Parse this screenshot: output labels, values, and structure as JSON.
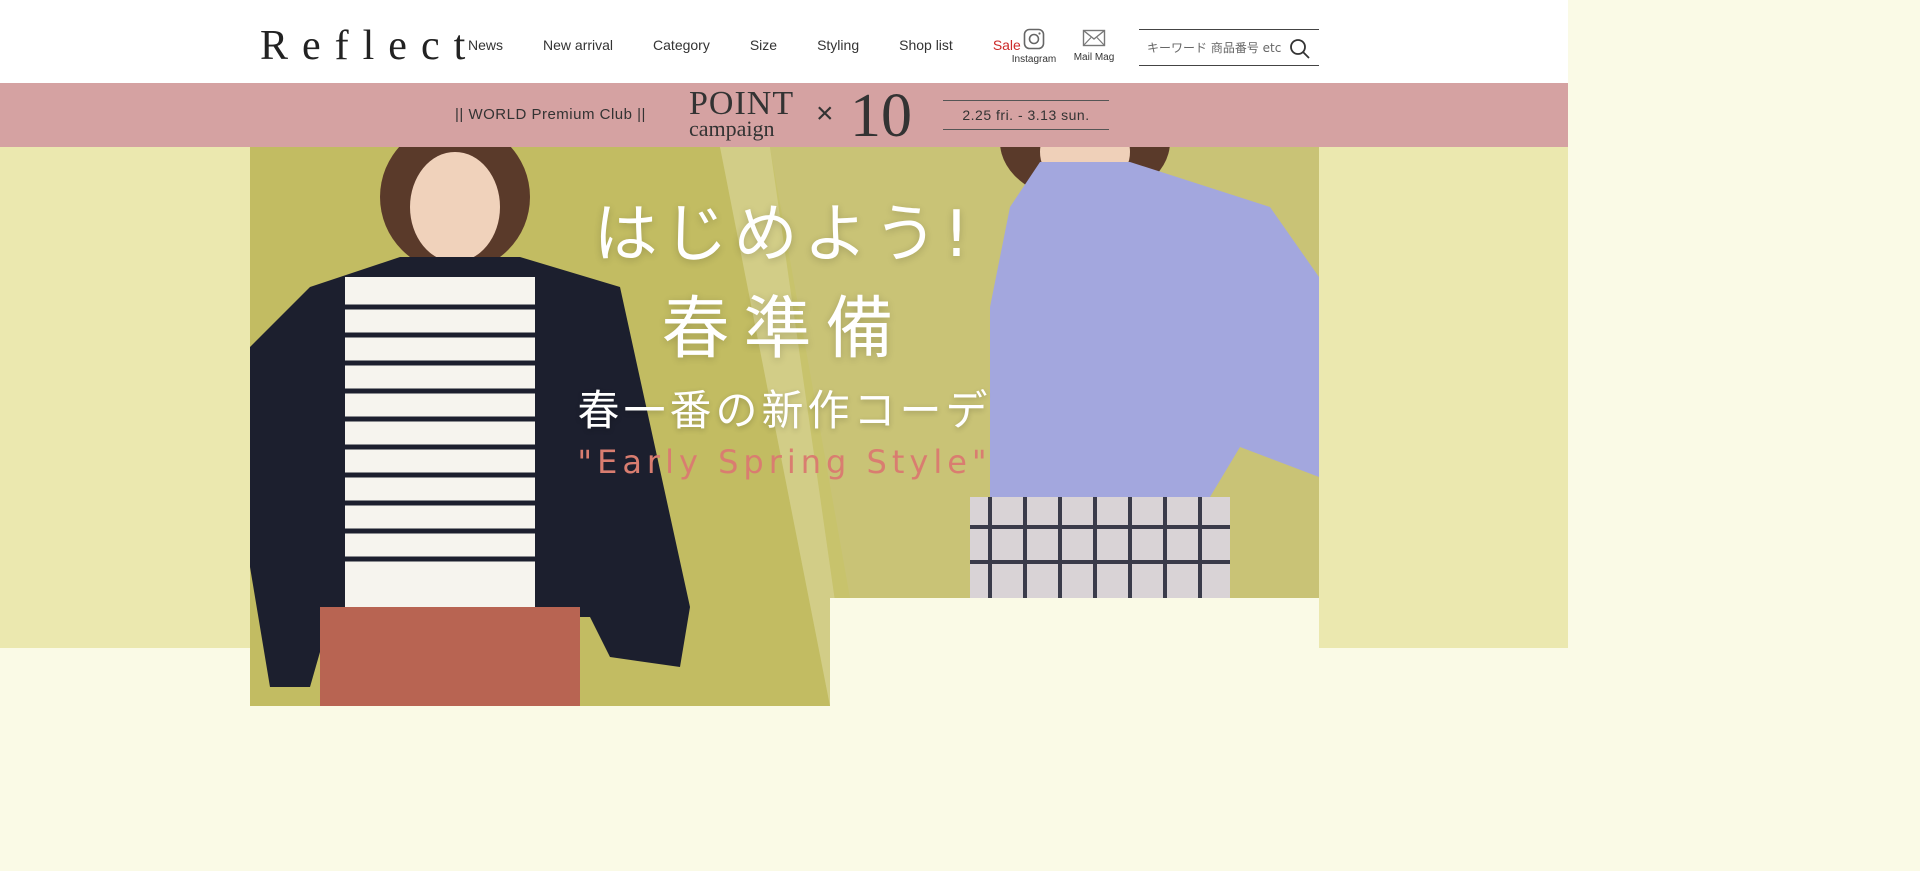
{
  "brand": {
    "logo": "Reflect"
  },
  "nav": {
    "items": [
      "News",
      "New arrival",
      "Category",
      "Size",
      "Styling",
      "Shop list"
    ],
    "sale": "Sale",
    "sale_color": "#cc2a2a"
  },
  "social": {
    "instagram": {
      "label": "Instagram",
      "icon": "instagram-icon"
    },
    "mailmag": {
      "label": "Mail Mag",
      "icon": "mail-icon"
    }
  },
  "search": {
    "placeholder": "キーワード 商品番号 etc",
    "icon": "search-icon"
  },
  "promo": {
    "club": "||  WORLD Premium Club  ||",
    "point": "POINT",
    "campaign": "campaign",
    "times": "×",
    "multiplier": "10",
    "dates": "2.25 fri.  -  3.13 sun.",
    "background": "#d5a2a2"
  },
  "hero": {
    "headline_1": "はじめよう!",
    "headline_2": "春準備",
    "subheadline": "春一番の新作コーデ",
    "tagline": "\"Early Spring Style\"",
    "background": "#ebe8af"
  }
}
